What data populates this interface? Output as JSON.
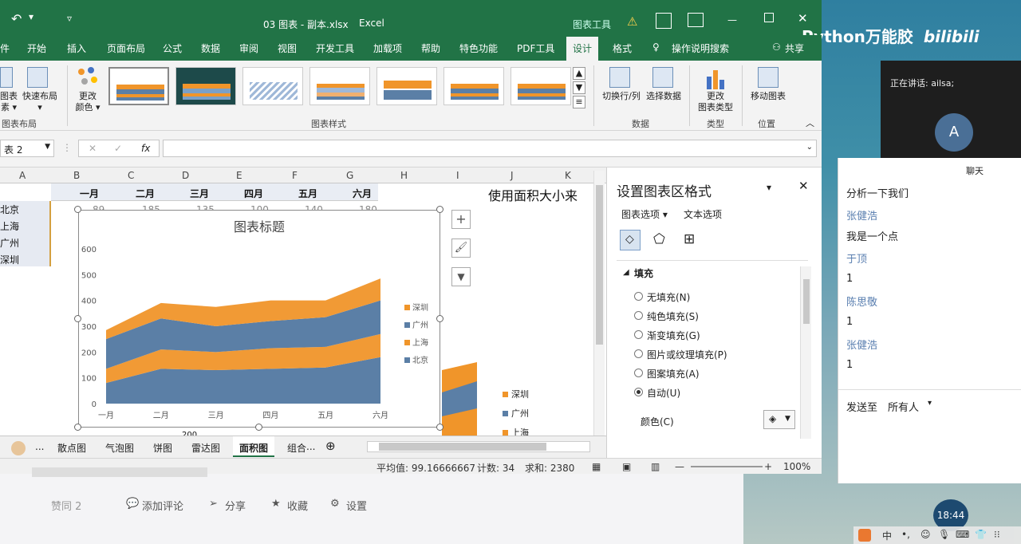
{
  "window": {
    "file_title": "03 图表 - 副本.xlsx",
    "app_name": "Excel",
    "context_tab": "图表工具",
    "share": "共享"
  },
  "ribbon_tabs": [
    "件",
    "开始",
    "插入",
    "页面布局",
    "公式",
    "数据",
    "审阅",
    "视图",
    "开发工具",
    "加载项",
    "帮助",
    "特色功能",
    "PDF工具",
    "设计",
    "格式"
  ],
  "ribbon_tab_active": "设计",
  "tell_me": "操作说明搜索",
  "ribbon": {
    "chart_element": "图表",
    "chart_element_sub": "素 ▾",
    "quick_layout": "快速布局",
    "quick_layout_sub": "▾",
    "change_color": "更改",
    "change_color_sub": "颜色 ▾",
    "group_layout": "图表布局",
    "group_styles": "图表样式",
    "switch_rowcol": "切换行/列",
    "select_data": "选择数据",
    "group_data": "数据",
    "change_type": "更改",
    "change_type_sub": "图表类型",
    "group_type": "类型",
    "move_chart": "移动图表",
    "group_location": "位置"
  },
  "formula_bar": {
    "name_box": "表 2",
    "fx": "fx",
    "value": ""
  },
  "columns": [
    "A",
    "B",
    "C",
    "D",
    "E",
    "F",
    "G",
    "H",
    "I",
    "J",
    "K"
  ],
  "sheet": {
    "months": [
      "一月",
      "二月",
      "三月",
      "四月",
      "五月",
      "六月"
    ],
    "row1_values": [
      "89",
      "185",
      "135",
      "100",
      "140",
      "180"
    ],
    "rows": [
      "北京",
      "上海",
      "广州",
      "深圳"
    ],
    "side_text": "使用面积大小来",
    "bottom_num": "200"
  },
  "chart_data": {
    "type": "area",
    "stacked": true,
    "title": "图表标题",
    "categories": [
      "一月",
      "二月",
      "三月",
      "四月",
      "五月",
      "六月"
    ],
    "ylim": [
      0,
      600
    ],
    "yticks": [
      "0",
      "100",
      "200",
      "300",
      "400",
      "500",
      "600"
    ],
    "legend_position": "right",
    "series": [
      {
        "name": "北京",
        "color": "#5b7fa6",
        "values": [
          80,
          135,
          130,
          135,
          140,
          180
        ]
      },
      {
        "name": "上海",
        "color": "#f0952a",
        "values": [
          55,
          75,
          70,
          80,
          80,
          90
        ]
      },
      {
        "name": "广州",
        "color": "#5b7fa6",
        "values": [
          115,
          120,
          100,
          105,
          115,
          130
        ]
      },
      {
        "name": "深圳",
        "color": "#f0952a",
        "values": [
          35,
          60,
          75,
          80,
          65,
          85
        ]
      }
    ]
  },
  "chart_tools": {
    "add": "+",
    "style": "🖌",
    "filter": "▼"
  },
  "sheet_tabs": [
    "...",
    "散点图",
    "气泡图",
    "饼图",
    "雷达图",
    "面积图",
    "组合",
    "..."
  ],
  "sheet_tab_active": "面积图",
  "status": {
    "average": "平均值: 99.16666667",
    "count": "计数: 34",
    "sum": "求和: 2380",
    "zoom": "100%"
  },
  "format_pane": {
    "title": "设置图表区格式",
    "tab_chart": "图表选项 ▾",
    "tab_text": "文本选项",
    "section": "填充",
    "options": [
      "无填充(N)",
      "纯色填充(S)",
      "渐变填充(G)",
      "图片或纹理填充(P)",
      "图案填充(A)",
      "自动(U)"
    ],
    "selected_option": "自动(U)",
    "color_label": "颜色(C)"
  },
  "bg_legend": [
    "深圳",
    "广州",
    "上海"
  ],
  "below_bar": {
    "like": "赞同 2",
    "comment": "添加评论",
    "share": "分享",
    "fav": "收藏",
    "settings": "设置"
  },
  "brand": "Python万能胶",
  "brand_logo": "bilibili",
  "meeting": {
    "speaking": "正在讲话: ailsa;",
    "avatar": "A"
  },
  "chat": {
    "header": "聊天",
    "messages": [
      {
        "name": "",
        "text": "分析一下我们"
      },
      {
        "name": "张健浩",
        "text": "我是一个点"
      },
      {
        "name": "于顶",
        "text": "1"
      },
      {
        "name": "陈思敬",
        "text": "1"
      },
      {
        "name": "张健浩",
        "text": "1"
      }
    ],
    "send_to_label": "发送至",
    "send_to_value": "所有人"
  },
  "clock": "18:44",
  "ime": "中"
}
